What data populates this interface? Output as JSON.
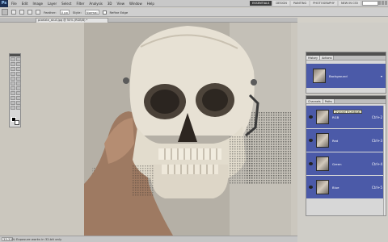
{
  "menubar": {
    "logo": "Ps",
    "items": [
      "File",
      "Edit",
      "Image",
      "Layer",
      "Select",
      "Filter",
      "Analysis",
      "3D",
      "View",
      "Window",
      "Help"
    ],
    "workspaces": [
      "ESSENTIALS",
      "DESIGN",
      "PAINTING",
      "PHOTOGRAPHY",
      "NEW IN CS5"
    ],
    "active_workspace": "ESSENTIALS"
  },
  "options": {
    "feather_label": "Feather:",
    "feather_value": "0 px",
    "style_label": "Style:",
    "style_value": "Normal",
    "checkbox_label": "Refine Edge"
  },
  "document": {
    "tab_title": "pixelate_skull.jpg @ 50% (RGB/8) *"
  },
  "status": {
    "zoom": "33.33%",
    "info": "Exposure works in 32-bit only"
  },
  "panels": {
    "history": {
      "tabs": [
        "History",
        "Actions"
      ],
      "rows": [
        {
          "label": "Background"
        }
      ]
    },
    "channels": {
      "tabs": [
        "Channels",
        "Paths"
      ],
      "rows": [
        {
          "label": "RGB",
          "shortcut": "Ctrl+2"
        },
        {
          "label": "Red",
          "shortcut": "Ctrl+3"
        },
        {
          "label": "Green",
          "shortcut": "Ctrl+4"
        },
        {
          "label": "Blue",
          "shortcut": "Ctrl+5"
        }
      ],
      "tooltip": "Channel thumbnail"
    }
  },
  "colors": {
    "fg": "#000000",
    "bg": "#ffffff",
    "selection": "#4b5aa8"
  }
}
